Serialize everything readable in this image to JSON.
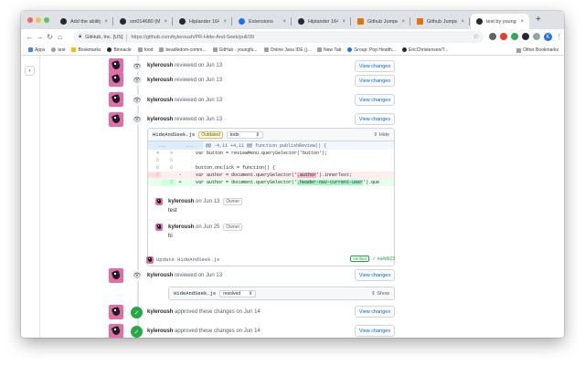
{
  "browser": {
    "tabs": [
      {
        "title": "Add the ability to",
        "icon": "github"
      },
      {
        "title": "sm014680 (Mu",
        "icon": "github"
      },
      {
        "title": "Hiplander 1640",
        "icon": "github"
      },
      {
        "title": "Extensions",
        "icon": "extensions"
      },
      {
        "title": "Hiplander 1640",
        "icon": "github"
      },
      {
        "title": "Github Jumper f",
        "icon": "jumper"
      },
      {
        "title": "Github Jumper f",
        "icon": "jumper"
      },
      {
        "title": "test by youngfu",
        "icon": "github"
      }
    ],
    "close_glyph": "×",
    "new_tab_glyph": "+",
    "site_identity": "GitHub, Inc. [US]",
    "url": "https://github.com/kyleroush/PR-Hide-And-Seek/pull/39",
    "profile_initial": "K",
    "bookmarks": [
      "Apps",
      "test",
      "Bookmarks",
      "Binnacle",
      "food",
      "beadledom-comm...",
      "GitHub - youngfu...",
      "Online Java IDE (j...",
      "New Tab",
      "Group: Pop Health...",
      "EricChristensen/T..."
    ],
    "other_bookmarks": "Other Bookmarks"
  },
  "timeline": {
    "toggle_glyph": "›",
    "reviews": [
      {
        "user": "kyleroush",
        "text": "reviewed on Jun 13",
        "button": "View changes"
      },
      {
        "user": "kyleroush",
        "text": "reviewed on Jun 13",
        "button": "View changes"
      },
      {
        "user": "kyleroush",
        "text": "reviewed on Jun 13",
        "button": "View changes"
      },
      {
        "user": "kyleroush",
        "text": "reviewed on Jun 13",
        "button": "View changes"
      }
    ],
    "review_box": {
      "file": "HideAndSeek.js",
      "outdated_label": "Outdated",
      "status": "todo",
      "hide_label": "Hide",
      "hunk_dots_left": "...",
      "hunk_dots_right": "...",
      "hunk_header": "@@ -4,11 +4,11 @@ function publishReview() {",
      "lines": [
        {
          "old": "4",
          "new": "4",
          "sign": "",
          "type": "ctx",
          "pre": "    var button = reviewMenu.querySelector('button');",
          "mid": "",
          "post": ""
        },
        {
          "old": "5",
          "new": "5",
          "sign": "",
          "type": "ctx",
          "pre": "",
          "mid": "",
          "post": ""
        },
        {
          "old": "6",
          "new": "6",
          "sign": "",
          "type": "ctx",
          "pre": "    button.onclick = function() {",
          "mid": "",
          "post": ""
        },
        {
          "old": "7",
          "new": "",
          "sign": "-",
          "type": "del",
          "pre": "      var author = document.querySelector('",
          "mid": ".author",
          "post": "').innerText;"
        },
        {
          "old": "",
          "new": "7",
          "sign": "+",
          "type": "add",
          "pre": "      var author = document.querySelector('",
          "mid": ".header-nav-current-user",
          "post": "').que"
        }
      ],
      "comments": [
        {
          "user": "kyleroush",
          "date": "on Jun 13",
          "badge": "Owner",
          "body": "test"
        },
        {
          "user": "kyleroush",
          "date": "on Jun 25",
          "badge": "Owner",
          "body": "hi"
        }
      ]
    },
    "commit": {
      "message": "Update HideAndSeek.js",
      "verified": "Verified",
      "sha": "✓ ea4db23"
    },
    "review_after_commit": {
      "user": "kyleroush",
      "text": "reviewed on Jun 13",
      "button": "View changes"
    },
    "file_box": {
      "file": "HideAndSeek.js",
      "status": "resolved",
      "show_label": "Show"
    },
    "approvals": [
      {
        "user": "kyleroush",
        "text": "approved these changes on Jun 14",
        "button": "View changes"
      },
      {
        "user": "kyleroush",
        "text": "approved these changes on Jun 14",
        "button": "View changes"
      }
    ]
  },
  "colors": {
    "accent": "#0366d6",
    "success": "#28a745",
    "avatar": "#e26da7",
    "del_bg": "#ffeef0",
    "add_bg": "#e6ffed"
  }
}
